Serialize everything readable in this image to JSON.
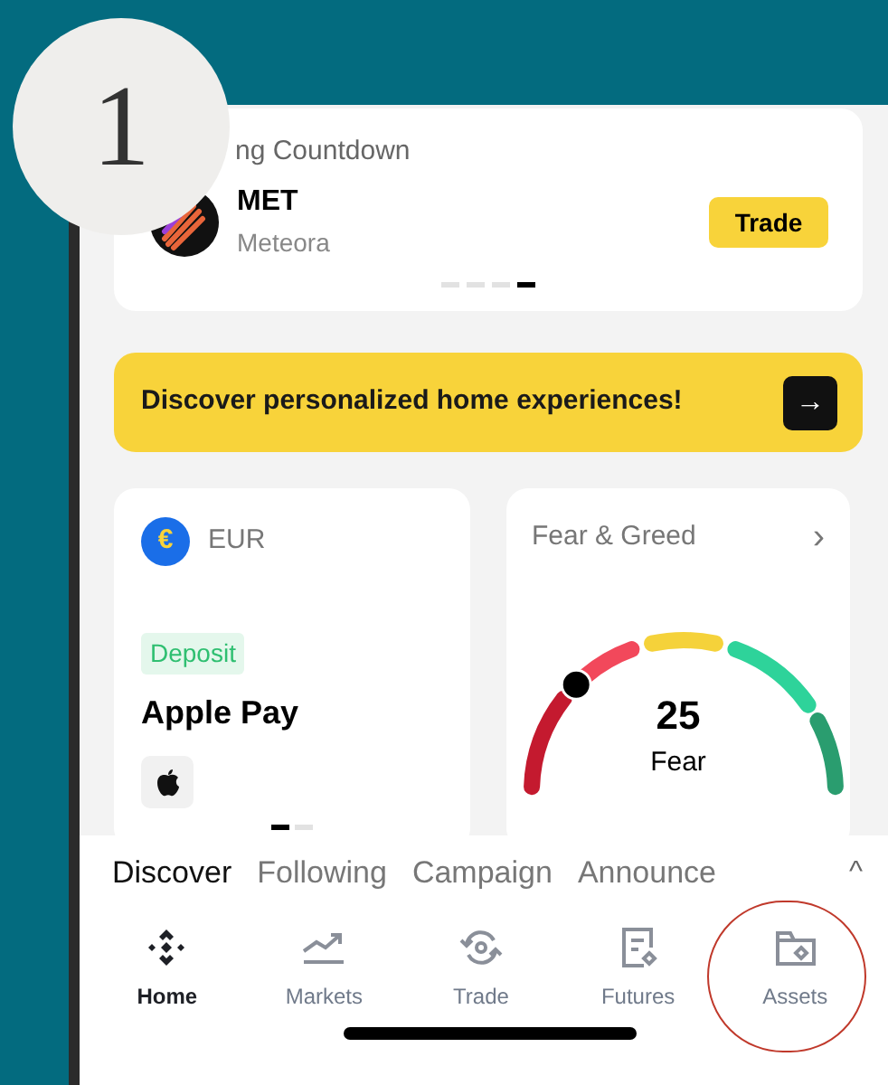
{
  "step_badge": {
    "number": "1"
  },
  "countdown_card": {
    "title": "ng Countdown",
    "symbol": "MET",
    "name": "Meteora",
    "button": "Trade",
    "pages": [
      {
        "selected": false
      },
      {
        "selected": false
      },
      {
        "selected": false
      },
      {
        "selected": true
      }
    ]
  },
  "banner": {
    "text": "Discover personalized home experiences!",
    "arrow": "→"
  },
  "currency_card": {
    "currency_symbol": "€",
    "currency": "EUR",
    "tag": "Deposit",
    "method": "Apple Pay",
    "pages": [
      {
        "selected": true
      },
      {
        "selected": false
      }
    ]
  },
  "fear_greed_card": {
    "title": "Fear & Greed",
    "chevron": "›",
    "level": 0.25,
    "value": "25",
    "label": "Fear"
  },
  "feed_tabs": [
    {
      "label": "Discover",
      "selected": true
    },
    {
      "label": "Following",
      "selected": false
    },
    {
      "label": "Campaign",
      "selected": false
    },
    {
      "label": "Announce",
      "selected": false
    }
  ],
  "feed_tabs_caret": "^",
  "nav": [
    {
      "kind": "home",
      "label": "Home",
      "selected": true,
      "highlighted": false
    },
    {
      "kind": "markets",
      "label": "Markets",
      "selected": false,
      "highlighted": false
    },
    {
      "kind": "trade",
      "label": "Trade",
      "selected": false,
      "highlighted": false
    },
    {
      "kind": "futures",
      "label": "Futures",
      "selected": false,
      "highlighted": false
    },
    {
      "kind": "assets",
      "label": "Assets",
      "selected": false,
      "highlighted": true
    }
  ]
}
